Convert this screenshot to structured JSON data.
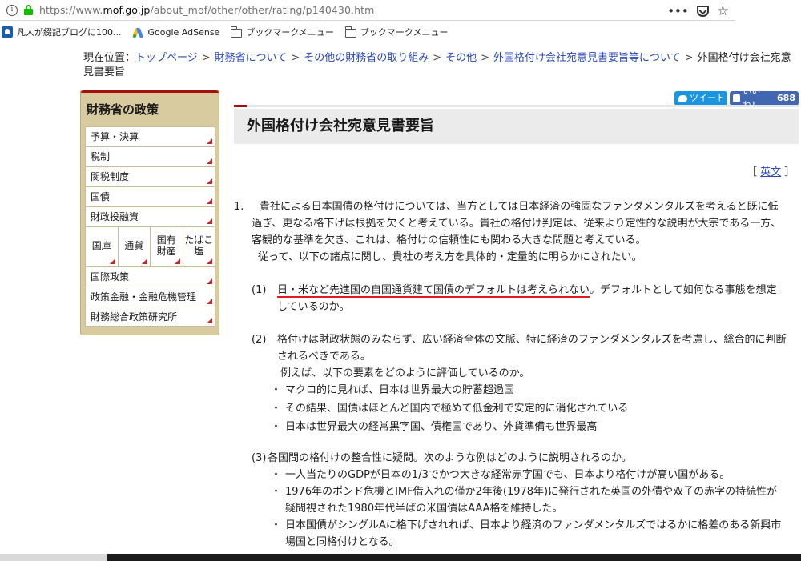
{
  "browser": {
    "url_prefix": "https://www.",
    "url_domain": "mof.go.jp",
    "url_path": "/about_mof/other/other/rating/p140430.htm",
    "menu_glyph": "•••",
    "star_glyph": "☆",
    "info_glyph": "i"
  },
  "bookmarks": [
    {
      "label": "凡人が綴記ブログに100..."
    },
    {
      "label": "Google AdSense"
    },
    {
      "label": "ブックマークメニュー"
    },
    {
      "label": "ブックマークメニュー"
    }
  ],
  "breadcrumb": {
    "prefix": "現在位置：",
    "links": [
      "トップページ",
      "財務省について",
      "その他の財務省の取り組み",
      "その他",
      "外国格付け会社宛意見書要旨等について"
    ],
    "sep": ">",
    "current": "外国格付け会社宛意見書要旨"
  },
  "sidebar": {
    "title": "財務省の政策",
    "items_top": [
      "予算・決算",
      "税制",
      "関税制度",
      "国債",
      "財政投融資"
    ],
    "grid": [
      "国庫",
      "通貨",
      "国有\n財産",
      "たばこ\n塩"
    ],
    "items_bottom": [
      "国際政策",
      "政策金融・金融危機管理",
      "財務総合政策研究所"
    ]
  },
  "social": {
    "tweet_label": "ツイート",
    "like_label": "いいね！",
    "like_count": "688"
  },
  "main": {
    "title": "外国格付け会社宛意見書要旨",
    "english_open": "［",
    "english_link": "英文",
    "english_close": "］",
    "p1_num": "1.",
    "p1_text": "貴社による日本国債の格付けについては、当方としては日本経済の強固なファンダメンタルズを考えると既に低過ぎ、更なる格下げは根拠を欠くと考えている。貴社の格付け判定は、従来より定性的な説明が大宗である一方、客観的な基準を欠き、これは、格付けの信頼性にも関わる大きな問題と考えている。",
    "p1_followup": "従って、以下の諸点に関し、貴社の考え方を具体的・定量的に明らかにされたい。",
    "q1_label": "(1)",
    "q1_underlined": "日・米など先進国の自国通貨建て国債のデフォルトは考えられない",
    "q1_rest": "。デフォルトとして如何なる事態を想定しているのか。",
    "q2_label": "(2)",
    "q2_text": "格付けは財政状態のみならず、広い経済全体の文脈、特に経済のファンダメンタルズを考慮し、総合的に判断されるべきである。",
    "q2_example": "例えば、以下の要素をどのように評価しているのか。",
    "q2_bullets": [
      "マクロ的に見れば、日本は世界最大の貯蓄超過国",
      "その結果、国債はほとんど国内で極めて低金利で安定的に消化されている",
      "日本は世界最大の経常黒字国、債権国であり、外貨準備も世界最高"
    ],
    "q3_label": "(3)",
    "q3_text": "各国間の格付けの整合性に疑問。次のような例はどのように説明されるのか。",
    "q3_bullets": [
      "一人当たりのGDPが日本の1/3でかつ大きな経常赤字国でも、日本より格付けが高い国がある。",
      "1976年のポンド危機とIMF借入れの僅か2年後(1978年)に発行された英国の外債や双子の赤字の持続性が疑問視された1980年代半ばの米国債はAAA格を維持した。",
      "日本国債がシングルAに格下げされれば、日本より経済のファンダメンタルズではるかに格差のある新興市場国と同格付けとなる。"
    ],
    "bullet_glyph": "・"
  }
}
